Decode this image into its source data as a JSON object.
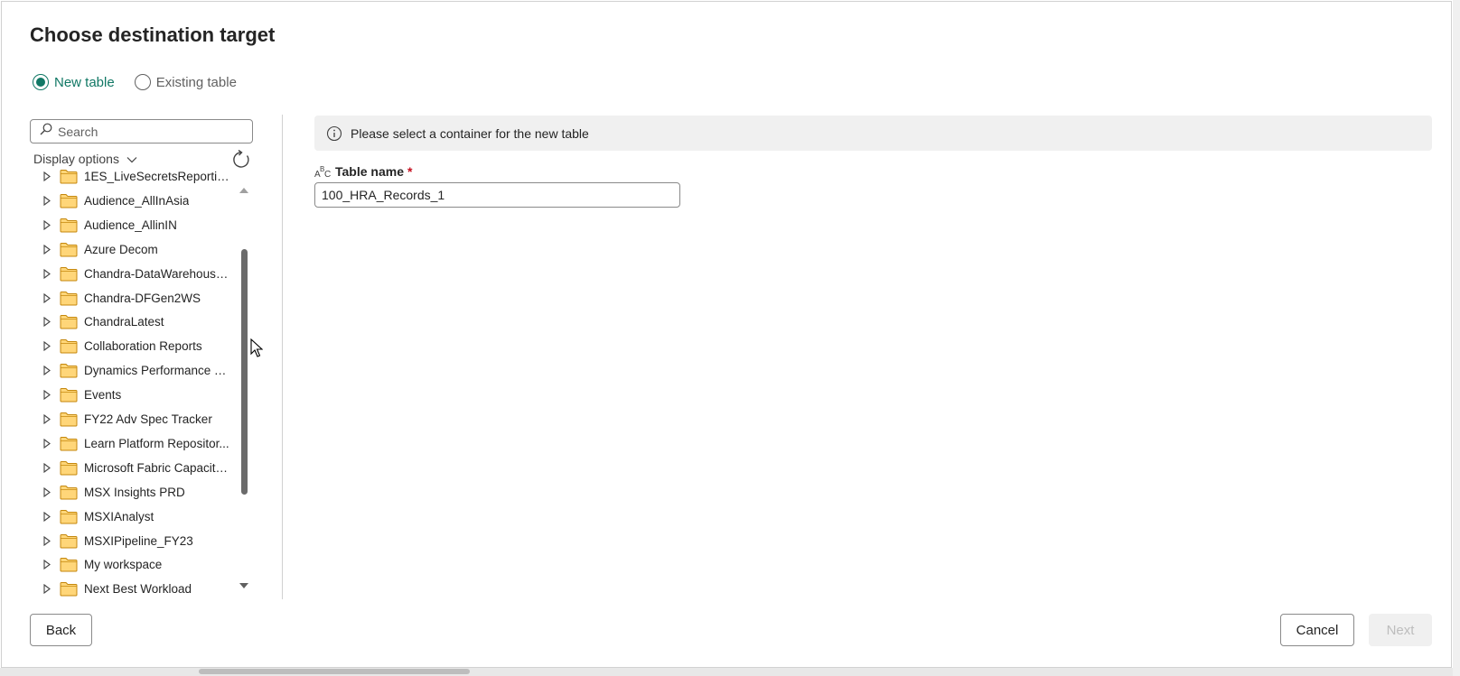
{
  "dialog": {
    "title": "Choose destination target"
  },
  "radio": {
    "new_table": "New table",
    "existing_table": "Existing table",
    "selected": "New table"
  },
  "navigator": {
    "search_placeholder": "Search",
    "display_options": "Display options",
    "items": [
      "1ES_LiveSecretsReporting",
      "Audience_AllInAsia",
      "Audience_AllinIN",
      "Azure Decom",
      "Chandra-DataWarehouse...",
      "Chandra-DFGen2WS",
      "ChandraLatest",
      "Collaboration Reports",
      "Dynamics Performance Te...",
      "Events",
      "FY22 Adv Spec Tracker",
      "Learn Platform Repositor...",
      "Microsoft Fabric Capacity...",
      "MSX Insights PRD",
      "MSXIAnalyst",
      "MSXIPipeline_FY23",
      "My workspace",
      "Next Best Workload"
    ]
  },
  "info": {
    "message": "Please select a container for the new table"
  },
  "table_name": {
    "label": "Table name",
    "required_mark": "*",
    "value": "100_HRA_Records_1"
  },
  "footer": {
    "back": "Back",
    "cancel": "Cancel",
    "next": "Next"
  },
  "colors": {
    "accent": "#117865",
    "folder_fill": "#ffd679",
    "folder_stroke": "#c4870c",
    "required": "#c50f1f"
  }
}
